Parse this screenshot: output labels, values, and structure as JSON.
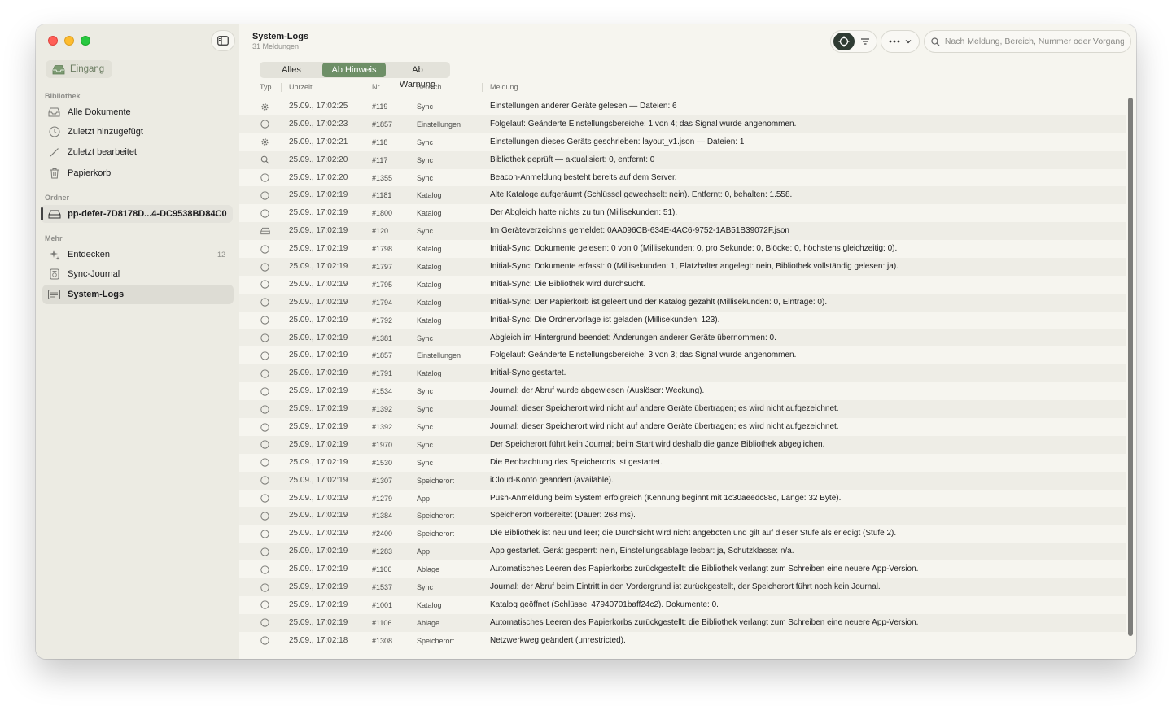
{
  "window": {
    "title": "System-Logs",
    "subtitle": "31 Meldungen"
  },
  "sidebar": {
    "inbox_label": "Eingang",
    "library_heading": "Bibliothek",
    "library_items": [
      {
        "label": "Alle Dokumente",
        "icon": "tray-icon"
      },
      {
        "label": "Zuletzt hinzugefügt",
        "icon": "clock-icon"
      },
      {
        "label": "Zuletzt bearbeitet",
        "icon": "pencil-icon"
      },
      {
        "label": "Papierkorb",
        "icon": "trash-icon"
      }
    ],
    "folders_heading": "Ordner",
    "folder_item": "pp-defer-7D8178D...4-DC9538BD84C0",
    "more_heading": "Mehr",
    "more_items": [
      {
        "label": "Entdecken",
        "icon": "sparkle-icon",
        "count": "12"
      },
      {
        "label": "Sync-Journal",
        "icon": "journal-icon",
        "count": ""
      },
      {
        "label": "System-Logs",
        "icon": "logs-icon",
        "count": "",
        "active": true
      }
    ]
  },
  "toolbar": {
    "search_placeholder": "Nach Meldung, Bereich, Nummer oder Vorgang"
  },
  "filter": {
    "segments": [
      "Alles",
      "Ab Hinweis",
      "Ab Warnung"
    ],
    "selected": "Ab Hinweis"
  },
  "columns": {
    "type": "Typ",
    "time": "Uhrzeit",
    "number": "Nr.",
    "area": "Bereich",
    "message": "Meldung"
  },
  "colors": {
    "accent": "#6e8f67",
    "sidebar_bg": "#ecebe3",
    "content_bg": "#f6f5ef"
  },
  "log_rows": [
    {
      "icon": "gear-icon",
      "time": "25.09., 17:02:25",
      "nr": "#119",
      "area": "Sync",
      "message": "Einstellungen anderer Geräte gelesen — Dateien: 6"
    },
    {
      "icon": "info-icon",
      "time": "25.09., 17:02:23",
      "nr": "#1857",
      "area": "Einstellungen",
      "message": "Folgelauf: Geänderte Einstellungsbereiche: 1 von 4; das Signal wurde angenommen."
    },
    {
      "icon": "gear-icon",
      "time": "25.09., 17:02:21",
      "nr": "#118",
      "area": "Sync",
      "message": "Einstellungen dieses Geräts geschrieben: layout_v1.json — Dateien: 1"
    },
    {
      "icon": "search-icon",
      "time": "25.09., 17:02:20",
      "nr": "#117",
      "area": "Sync",
      "message": "Bibliothek geprüft — aktualisiert: 0, entfernt: 0"
    },
    {
      "icon": "info-icon",
      "time": "25.09., 17:02:20",
      "nr": "#1355",
      "area": "Sync",
      "message": "Beacon-Anmeldung besteht bereits auf dem Server."
    },
    {
      "icon": "info-icon",
      "time": "25.09., 17:02:19",
      "nr": "#1181",
      "area": "Katalog",
      "message": "Alte Kataloge aufgeräumt (Schlüssel gewechselt: nein). Entfernt: 0, behalten: 1.558."
    },
    {
      "icon": "info-icon",
      "time": "25.09., 17:02:19",
      "nr": "#1800",
      "area": "Katalog",
      "message": "Der Abgleich hatte nichts zu tun (Millisekunden: 51)."
    },
    {
      "icon": "drive-icon",
      "time": "25.09., 17:02:19",
      "nr": "#120",
      "area": "Sync",
      "message": "Im Geräteverzeichnis gemeldet: 0AA096CB-634E-4AC6-9752-1AB51B39072F.json"
    },
    {
      "icon": "info-icon",
      "time": "25.09., 17:02:19",
      "nr": "#1798",
      "area": "Katalog",
      "message": "Initial-Sync: Dokumente gelesen: 0 von 0 (Millisekunden: 0, pro Sekunde: 0, Blöcke: 0, höchstens gleichzeitig: 0)."
    },
    {
      "icon": "info-icon",
      "time": "25.09., 17:02:19",
      "nr": "#1797",
      "area": "Katalog",
      "message": "Initial-Sync: Dokumente erfasst: 0 (Millisekunden: 1, Platzhalter angelegt: nein, Bibliothek vollständig gelesen: ja)."
    },
    {
      "icon": "info-icon",
      "time": "25.09., 17:02:19",
      "nr": "#1795",
      "area": "Katalog",
      "message": "Initial-Sync: Die Bibliothek wird durchsucht."
    },
    {
      "icon": "info-icon",
      "time": "25.09., 17:02:19",
      "nr": "#1794",
      "area": "Katalog",
      "message": "Initial-Sync: Der Papierkorb ist geleert und der Katalog gezählt (Millisekunden: 0, Einträge: 0)."
    },
    {
      "icon": "info-icon",
      "time": "25.09., 17:02:19",
      "nr": "#1792",
      "area": "Katalog",
      "message": "Initial-Sync: Die Ordnervorlage ist geladen (Millisekunden: 123)."
    },
    {
      "icon": "info-icon",
      "time": "25.09., 17:02:19",
      "nr": "#1381",
      "area": "Sync",
      "message": "Abgleich im Hintergrund beendet: Änderungen anderer Geräte übernommen: 0."
    },
    {
      "icon": "info-icon",
      "time": "25.09., 17:02:19",
      "nr": "#1857",
      "area": "Einstellungen",
      "message": "Folgelauf: Geänderte Einstellungsbereiche: 3 von 3; das Signal wurde angenommen."
    },
    {
      "icon": "info-icon",
      "time": "25.09., 17:02:19",
      "nr": "#1791",
      "area": "Katalog",
      "message": "Initial-Sync gestartet."
    },
    {
      "icon": "info-icon",
      "time": "25.09., 17:02:19",
      "nr": "#1534",
      "area": "Sync",
      "message": "Journal: der Abruf wurde abgewiesen (Auslöser: Weckung)."
    },
    {
      "icon": "info-icon",
      "time": "25.09., 17:02:19",
      "nr": "#1392",
      "area": "Sync",
      "message": "Journal: dieser Speicherort wird nicht auf andere Geräte übertragen; es wird nicht aufgezeichnet."
    },
    {
      "icon": "info-icon",
      "time": "25.09., 17:02:19",
      "nr": "#1392",
      "area": "Sync",
      "message": "Journal: dieser Speicherort wird nicht auf andere Geräte übertragen; es wird nicht aufgezeichnet."
    },
    {
      "icon": "info-icon",
      "time": "25.09., 17:02:19",
      "nr": "#1970",
      "area": "Sync",
      "message": "Der Speicherort führt kein Journal; beim Start wird deshalb die ganze Bibliothek abgeglichen."
    },
    {
      "icon": "info-icon",
      "time": "25.09., 17:02:19",
      "nr": "#1530",
      "area": "Sync",
      "message": "Die Beobachtung des Speicherorts ist gestartet."
    },
    {
      "icon": "info-icon",
      "time": "25.09., 17:02:19",
      "nr": "#1307",
      "area": "Speicherort",
      "message": "iCloud-Konto geändert (available)."
    },
    {
      "icon": "info-icon",
      "time": "25.09., 17:02:19",
      "nr": "#1279",
      "area": "App",
      "message": "Push-Anmeldung beim System erfolgreich (Kennung beginnt mit 1c30aeedc88c, Länge: 32 Byte)."
    },
    {
      "icon": "info-icon",
      "time": "25.09., 17:02:19",
      "nr": "#1384",
      "area": "Speicherort",
      "message": "Speicherort vorbereitet (Dauer: 268 ms)."
    },
    {
      "icon": "info-icon",
      "time": "25.09., 17:02:19",
      "nr": "#2400",
      "area": "Speicherort",
      "message": "Die Bibliothek ist neu und leer; die Durchsicht wird nicht angeboten und gilt auf dieser Stufe als erledigt (Stufe 2)."
    },
    {
      "icon": "info-icon",
      "time": "25.09., 17:02:19",
      "nr": "#1283",
      "area": "App",
      "message": "App gestartet. Gerät gesperrt: nein, Einstellungsablage lesbar: ja, Schutzklasse: n/a."
    },
    {
      "icon": "info-icon",
      "time": "25.09., 17:02:19",
      "nr": "#1106",
      "area": "Ablage",
      "message": "Automatisches Leeren des Papierkorbs zurückgestellt: die Bibliothek verlangt zum Schreiben eine neuere App-Version."
    },
    {
      "icon": "info-icon",
      "time": "25.09., 17:02:19",
      "nr": "#1537",
      "area": "Sync",
      "message": "Journal: der Abruf beim Eintritt in den Vordergrund ist zurückgestellt, der Speicherort führt noch kein Journal."
    },
    {
      "icon": "info-icon",
      "time": "25.09., 17:02:19",
      "nr": "#1001",
      "area": "Katalog",
      "message": "Katalog geöffnet (Schlüssel 47940701baff24c2). Dokumente: 0."
    },
    {
      "icon": "info-icon",
      "time": "25.09., 17:02:19",
      "nr": "#1106",
      "area": "Ablage",
      "message": "Automatisches Leeren des Papierkorbs zurückgestellt: die Bibliothek verlangt zum Schreiben eine neuere App-Version."
    },
    {
      "icon": "info-icon",
      "time": "25.09., 17:02:18",
      "nr": "#1308",
      "area": "Speicherort",
      "message": "Netzwerkweg geändert (unrestricted)."
    }
  ]
}
